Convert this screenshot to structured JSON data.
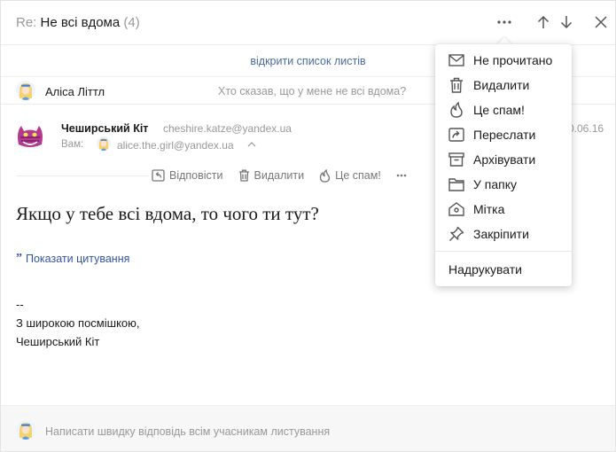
{
  "header": {
    "re_prefix": "Re:",
    "subject": "Не всі вдома",
    "count": "(4)"
  },
  "thread": {
    "open_list_label": "відкрити список листів",
    "collapsed": {
      "sender": "Аліса Літтл",
      "snippet": "Хто сказав, що у мене не всі вдома?"
    }
  },
  "message": {
    "from_name": "Чеширський Кіт",
    "from_email": "cheshire.katze@yandex.ua",
    "to_label": "Вам:",
    "to_email": "alice.the.girl@yandex.ua",
    "date": "0.06.16",
    "actions": {
      "reply": "Відповісти",
      "delete": "Видалити",
      "spam": "Це спам!"
    },
    "body": "Якщо у тебе всі вдома, то чого ти тут?",
    "show_quote": "Показати цитування",
    "signature": [
      "--",
      "З широкою посмішкою,",
      "Чеширський Кіт"
    ]
  },
  "quick_reply": {
    "placeholder": "Написати швидку відповідь всім учасникам листування"
  },
  "menu": {
    "items": [
      {
        "label": "Не прочитано",
        "icon": "envelope-icon"
      },
      {
        "label": "Видалити",
        "icon": "trash-icon"
      },
      {
        "label": "Це спам!",
        "icon": "flame-icon"
      },
      {
        "label": "Переслати",
        "icon": "forward-icon"
      },
      {
        "label": "Архівувати",
        "icon": "archive-icon"
      },
      {
        "label": "У папку",
        "icon": "folder-icon"
      },
      {
        "label": "Мітка",
        "icon": "label-icon"
      },
      {
        "label": "Закріпити",
        "icon": "pin-icon"
      }
    ],
    "print_label": "Надрукувати"
  },
  "colors": {
    "link": "#4b6b9a",
    "quote_link": "#3454a4",
    "muted": "#999999",
    "icon": "#555555"
  }
}
